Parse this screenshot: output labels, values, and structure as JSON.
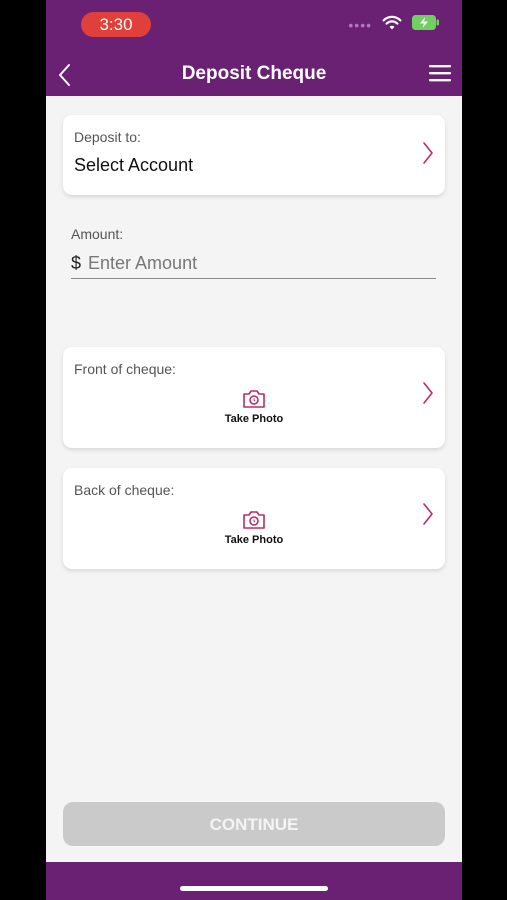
{
  "status_bar": {
    "time": "3:30",
    "signal_icon": "signal-dots",
    "wifi_icon": "wifi-icon",
    "battery_icon": "battery-charging-icon"
  },
  "nav": {
    "title": "Deposit Cheque",
    "back_icon": "chevron-left-icon",
    "menu_icon": "hamburger-menu-icon"
  },
  "deposit_to": {
    "label": "Deposit to:",
    "value": "Select Account"
  },
  "amount": {
    "label": "Amount:",
    "currency": "$",
    "placeholder": "Enter Amount"
  },
  "front_cheque": {
    "label": "Front of cheque:",
    "action": "Take Photo"
  },
  "back_cheque": {
    "label": "Back of cheque:",
    "action": "Take Photo"
  },
  "continue_label": "CONTINUE",
  "colors": {
    "brand": "#6a2073",
    "accent": "#b0306a",
    "time_pill": "#e0403a",
    "disabled_button": "#cacaca"
  }
}
